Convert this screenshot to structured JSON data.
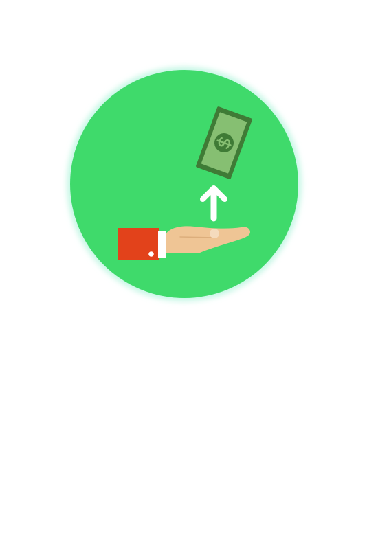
{
  "illustration": {
    "icons": [
      "hand-icon",
      "dollar-bill-icon",
      "up-arrow-icon",
      "dollar-sign-icon"
    ],
    "colors": {
      "background": "#ffffff",
      "circle": "#3fda6b",
      "circle_glow": "#c8f7e6",
      "bill_dark": "#3f7b36",
      "bill_light": "#86bf72",
      "arrow": "#ffffff",
      "sleeve": "#e2421b",
      "cuff": "#ffffff",
      "hand": "#efc595",
      "thumb": "#f5dbbd"
    }
  }
}
